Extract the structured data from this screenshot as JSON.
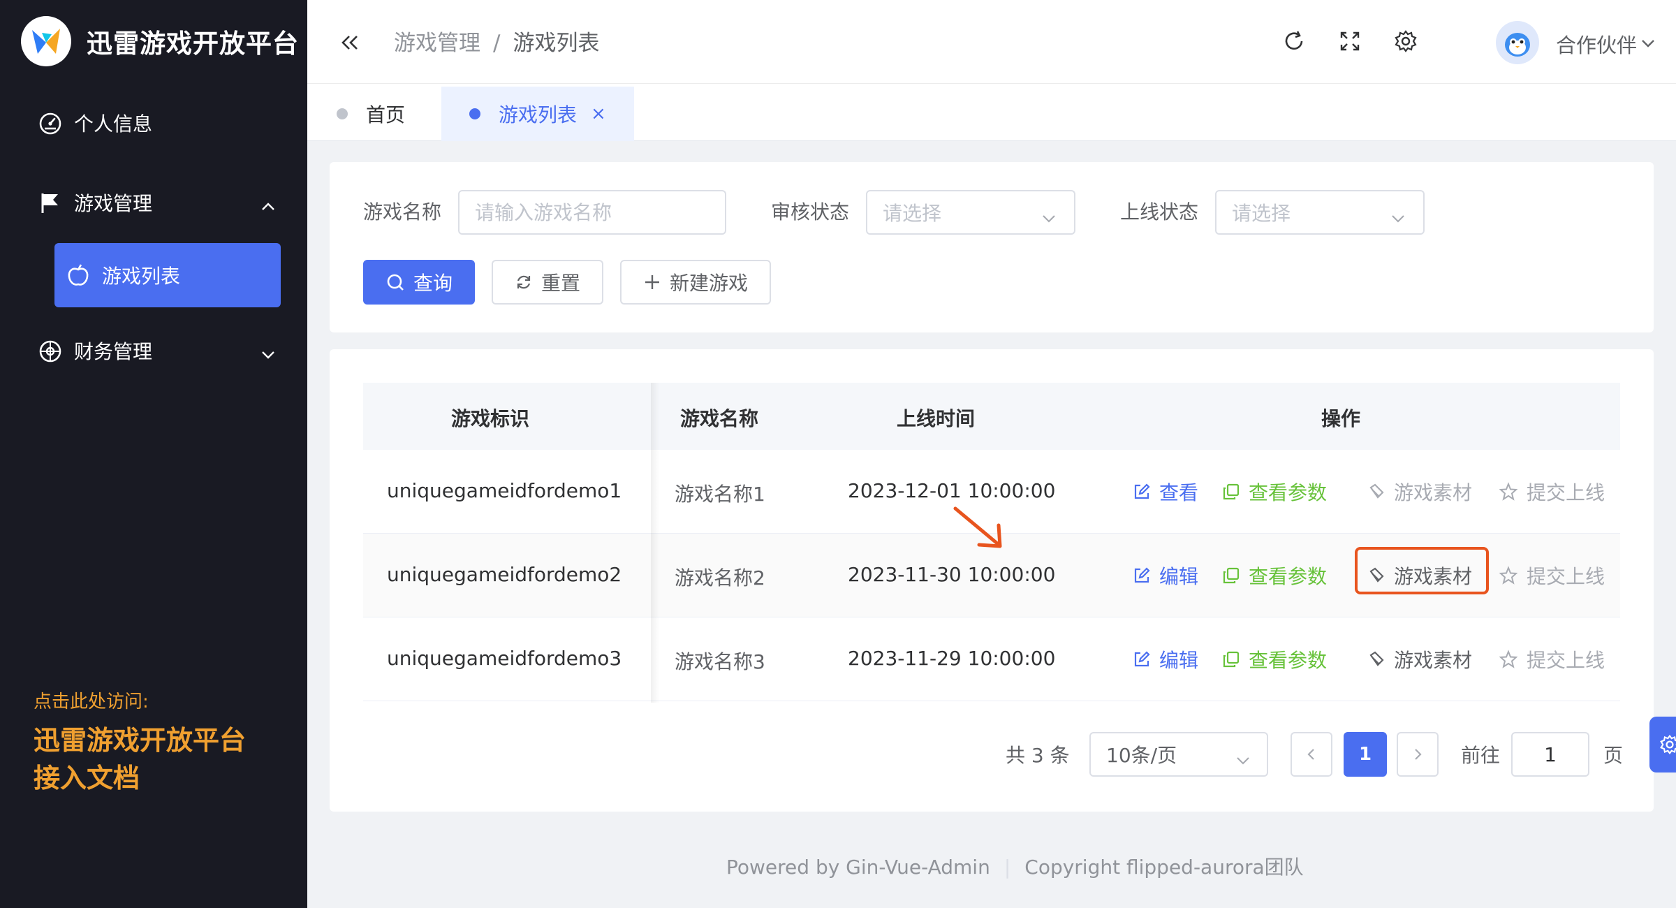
{
  "brand": {
    "title": "迅雷游戏开放平台"
  },
  "sidebar": {
    "items": [
      {
        "label": "个人信息",
        "icon": "gauge-icon"
      },
      {
        "label": "游戏管理",
        "icon": "flag-icon",
        "expanded": true
      },
      {
        "label": "游戏列表",
        "icon": "apple-icon",
        "active": true
      },
      {
        "label": "财务管理",
        "icon": "compass-icon",
        "expanded": false
      }
    ],
    "promo": {
      "hint": "点击此处访问:",
      "line1": "迅雷游戏开放平台",
      "line2": "接入文档"
    }
  },
  "header": {
    "breadcrumb": [
      "游戏管理",
      "游戏列表"
    ],
    "separator": "/",
    "user": "合作伙伴"
  },
  "tabs": [
    {
      "label": "首页",
      "active": false
    },
    {
      "label": "游戏列表",
      "active": true,
      "close": "×"
    }
  ],
  "search": {
    "name_label": "游戏名称",
    "name_placeholder": "请输入游戏名称",
    "review_label": "审核状态",
    "review_placeholder": "请选择",
    "online_label": "上线状态",
    "online_placeholder": "请选择",
    "query_btn": "查询",
    "reset_btn": "重置",
    "new_btn": "新建游戏"
  },
  "table": {
    "columns": [
      "游戏标识",
      "游戏名称",
      "上线时间",
      "操作"
    ],
    "rows": [
      {
        "id": "uniquegameidfordemo1",
        "name": "游戏名称1",
        "time": "2023-12-01 10:00:00",
        "actions": [
          "查看",
          "查看参数",
          "游戏素材",
          "提交上线"
        ]
      },
      {
        "id": "uniquegameidfordemo2",
        "name": "游戏名称2",
        "time": "2023-11-30 10:00:00",
        "actions": [
          "编辑",
          "查看参数",
          "游戏素材",
          "提交上线"
        ]
      },
      {
        "id": "uniquegameidfordemo3",
        "name": "游戏名称3",
        "time": "2023-11-29 10:00:00",
        "actions": [
          "编辑",
          "查看参数",
          "游戏素材",
          "提交上线"
        ]
      }
    ]
  },
  "pagination": {
    "total": "共 3 条",
    "page_size": "10条/页",
    "current": "1",
    "goto_label": "前往",
    "goto_value": "1",
    "page_unit": "页"
  },
  "footer": {
    "powered": "Powered by  Gin-Vue-Admin",
    "separator": "|",
    "copyright": "Copyright  flipped-aurora团队"
  },
  "colors": {
    "primary": "#4a6ef0",
    "success": "#67c23a",
    "sidebar": "#191a23",
    "promo": "#f0a030",
    "annotation": "#e8541e"
  }
}
